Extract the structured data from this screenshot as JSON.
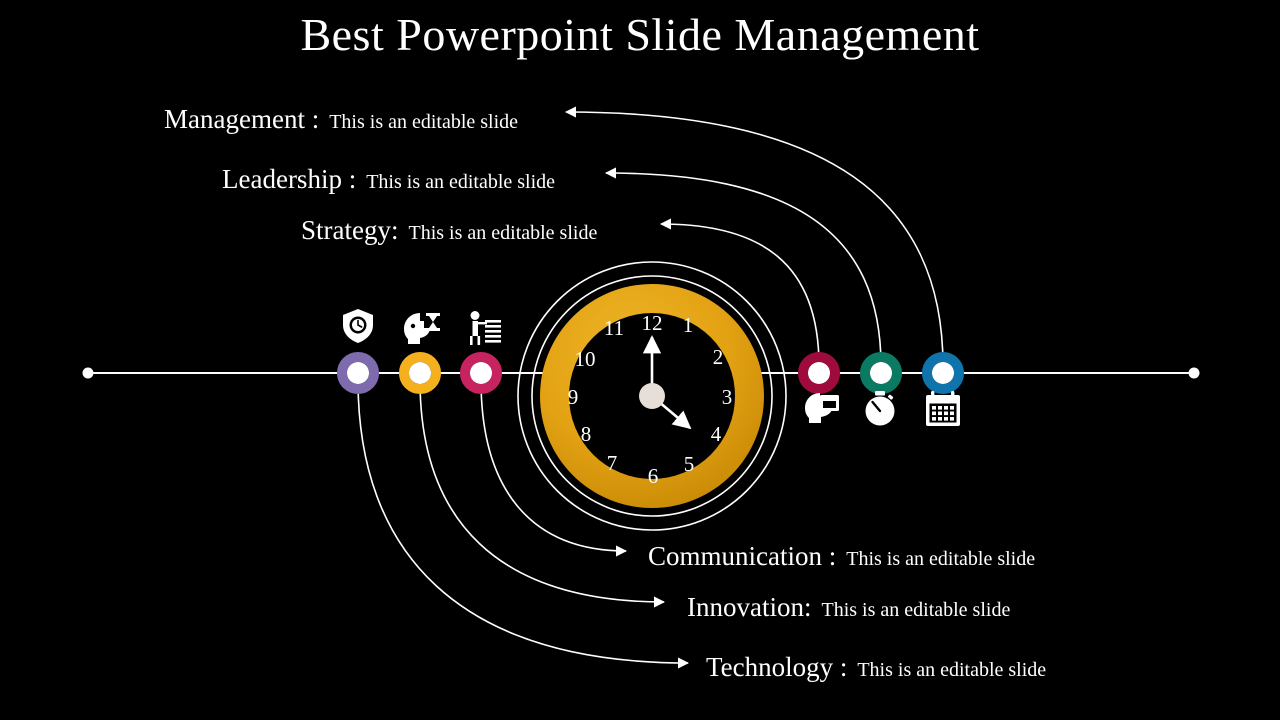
{
  "slide": {
    "title": "Best Powerpoint Slide Management",
    "background_color": "#000000",
    "text_color": "#ffffff"
  },
  "timeline": {
    "line_color": "#ffffff",
    "endpoint_left": "●",
    "endpoint_right": "●",
    "nodes": [
      {
        "id": "management",
        "icon": "shield-clock-icon",
        "ring_color": "#7d6bae",
        "side": "left"
      },
      {
        "id": "leadership",
        "icon": "head-hourglass-icon",
        "ring_color": "#f5b01e",
        "side": "left"
      },
      {
        "id": "strategy",
        "icon": "presenter-icon",
        "ring_color": "#c72361",
        "side": "left"
      },
      {
        "id": "communication",
        "icon": "head-calendar-icon",
        "ring_color": "#9e0b3c",
        "side": "right"
      },
      {
        "id": "innovation",
        "icon": "stopwatch-icon",
        "ring_color": "#0b7a63",
        "side": "right"
      },
      {
        "id": "technology",
        "icon": "calendar-icon",
        "ring_color": "#0f74ab",
        "side": "right"
      }
    ]
  },
  "labels": {
    "management": {
      "key": "Management :",
      "value": "This is an editable slide"
    },
    "leadership": {
      "key": "Leadership :",
      "value": "This is an editable slide"
    },
    "strategy": {
      "key": "Strategy:",
      "value": "This is an editable slide"
    },
    "communication": {
      "key": "Communication :",
      "value": "This is an editable slide"
    },
    "innovation": {
      "key": "Innovation:",
      "value": "This is an editable slide"
    },
    "technology": {
      "key": "Technology :",
      "value": "This is an editable slide"
    }
  },
  "clock": {
    "ring_color": "#e2a113",
    "face_color": "#000000",
    "hub_color": "#e5ded9",
    "hand_color": "#ffffff",
    "numbers": [
      "1",
      "2",
      "3",
      "4",
      "5",
      "6",
      "7",
      "8",
      "9",
      "10",
      "11",
      "12"
    ],
    "minute_hand_points_to": "12",
    "hour_hand_points_to": "4",
    "orbit_rings": 2
  }
}
